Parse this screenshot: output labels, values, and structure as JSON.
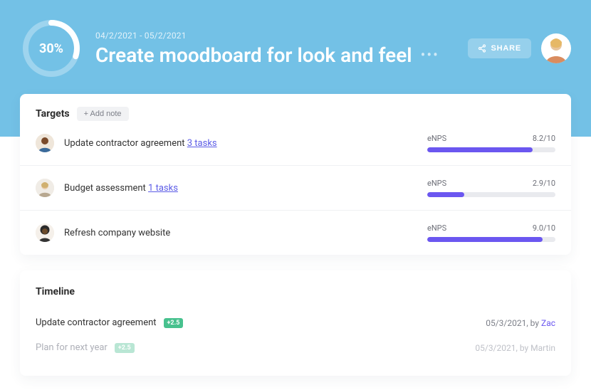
{
  "header": {
    "progress_pct_label": "30%",
    "progress_value": 30,
    "date_range": "04/2/2021 - 05/2/2021",
    "title": "Create moodboard for look and feel",
    "share_label": "SHARE"
  },
  "targets": {
    "heading": "Targets",
    "add_note_label": "+ Add note",
    "rows": [
      {
        "title": "Update contractor agreement",
        "tasks_label": "3 tasks",
        "metric_label": "eNPS",
        "metric_value": "8.2/10",
        "metric_pct": 82,
        "avatar": "person-1"
      },
      {
        "title": "Budget assessment",
        "tasks_label": "1 tasks",
        "metric_label": "eNPS",
        "metric_value": "2.9/10",
        "metric_pct": 29,
        "avatar": "person-2"
      },
      {
        "title": "Refresh company website",
        "tasks_label": "",
        "metric_label": "eNPS",
        "metric_value": "9.0/10",
        "metric_pct": 90,
        "avatar": "person-3"
      }
    ]
  },
  "timeline": {
    "heading": "Timeline",
    "rows": [
      {
        "title": "Update contractor agreement",
        "badge": "+2.5",
        "date": "05/3/2021",
        "by": "by",
        "author": "Zac",
        "faded": false
      },
      {
        "title": "Plan for next year",
        "badge": "+2.5",
        "date": "05/3/2021",
        "by": "by",
        "author": "Martin",
        "faded": true
      }
    ]
  }
}
